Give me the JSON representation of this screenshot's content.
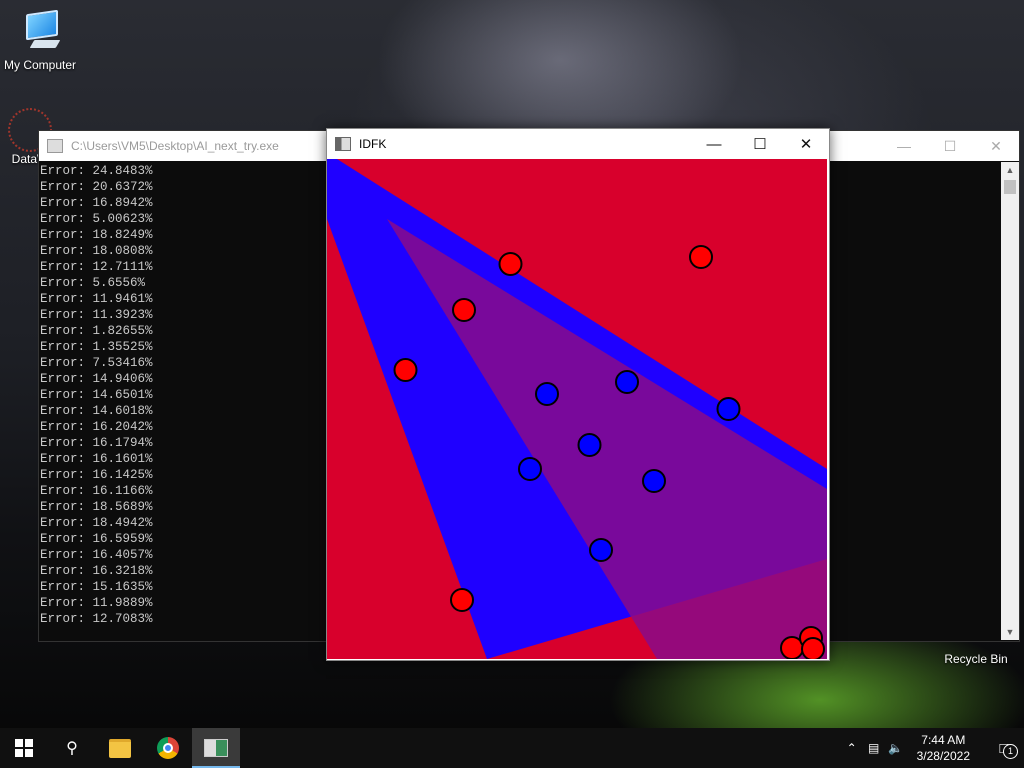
{
  "desktop": {
    "my_computer_label": "My Computer",
    "datawrapper_label": "DataW",
    "recycle_bin_label": "Recycle Bin"
  },
  "console": {
    "title": "C:\\Users\\VM5\\Desktop\\AI_next_try.exe",
    "lines": [
      "Error: 24.8483%",
      "Error: 20.6372%",
      "Error: 16.8942%",
      "Error: 5.00623%",
      "Error: 18.8249%",
      "Error: 18.0808%",
      "Error: 12.7111%",
      "Error: 5.6556%",
      "Error: 11.9461%",
      "Error: 11.3923%",
      "Error: 1.82655%",
      "Error: 1.35525%",
      "Error: 7.53416%",
      "Error: 14.9406%",
      "Error: 14.6501%",
      "Error: 14.6018%",
      "Error: 16.2042%",
      "Error: 16.1794%",
      "Error: 16.1601%",
      "Error: 16.1425%",
      "Error: 16.1166%",
      "Error: 18.5689%",
      "Error: 18.4942%",
      "Error: 16.5959%",
      "Error: 16.4057%",
      "Error: 16.3218%",
      "Error: 15.1635%",
      "Error: 11.9889%",
      "Error: 12.7083%"
    ]
  },
  "idfk": {
    "title": "IDFK",
    "colors": {
      "red": "#d8002c",
      "blue": "#1f00ff",
      "purple": "#8a0a8a"
    },
    "red_points": [
      [
        0.367,
        0.21
      ],
      [
        0.748,
        0.196
      ],
      [
        0.274,
        0.302
      ],
      [
        0.157,
        0.422
      ],
      [
        0.27,
        0.882
      ],
      [
        0.93,
        0.978
      ],
      [
        0.968,
        0.958
      ],
      [
        0.972,
        0.98
      ]
    ],
    "blue_points": [
      [
        0.44,
        0.47
      ],
      [
        0.6,
        0.446
      ],
      [
        0.803,
        0.5
      ],
      [
        0.525,
        0.572
      ],
      [
        0.406,
        0.62
      ],
      [
        0.654,
        0.644
      ],
      [
        0.548,
        0.782
      ]
    ]
  },
  "taskbar": {
    "time": "7:44 AM",
    "date": "3/28/2022",
    "notifications": "1"
  }
}
